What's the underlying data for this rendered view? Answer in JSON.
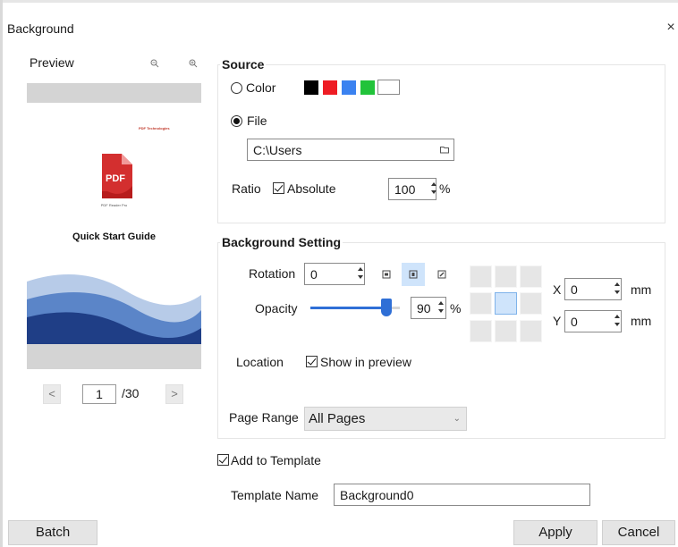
{
  "window": {
    "title": "Background",
    "close_glyph": "×"
  },
  "preview": {
    "label": "Preview",
    "zoom_out_icon": "zoom-out-icon",
    "zoom_in_icon": "zoom-in-icon",
    "doc": {
      "brand": "PDF Technologies",
      "icon_text": "PDF",
      "product": "PDF Reader Pro",
      "heading": "Quick Start Guide"
    },
    "pager": {
      "prev_glyph": "<",
      "next_glyph": ">",
      "current": "1",
      "total": "/30"
    }
  },
  "source": {
    "title": "Source",
    "color_label": "Color",
    "color_selected": false,
    "swatches": [
      "#000000",
      "#ee1c24",
      "#3b82f0",
      "#22c33a",
      "#ffffff"
    ],
    "file_label": "File",
    "file_selected": true,
    "file_path": "C:\\Users",
    "folder_icon": "folder-icon",
    "ratio_label": "Ratio",
    "absolute_label": "Absolute",
    "absolute_checked": true,
    "ratio_value": "100",
    "ratio_unit": "%"
  },
  "bg_setting": {
    "title": "Background Setting",
    "rotation_label": "Rotation",
    "rotation_value": "0",
    "opacity_label": "Opacity",
    "opacity_value": "90",
    "opacity_percent": 90,
    "opacity_unit": "%",
    "x_label": "X",
    "x_value": "0",
    "y_label": "Y",
    "y_value": "0",
    "unit_mm": "mm",
    "location_label": "Location",
    "show_in_preview_label": "Show in preview",
    "show_in_preview_checked": true,
    "page_range_label": "Page Range",
    "page_range_value": "All Pages",
    "selected_position": "center"
  },
  "template": {
    "add_label": "Add to Template",
    "add_checked": true,
    "name_label": "Template Name",
    "name_value": "Background0"
  },
  "buttons": {
    "batch": "Batch",
    "apply": "Apply",
    "cancel": "Cancel"
  }
}
